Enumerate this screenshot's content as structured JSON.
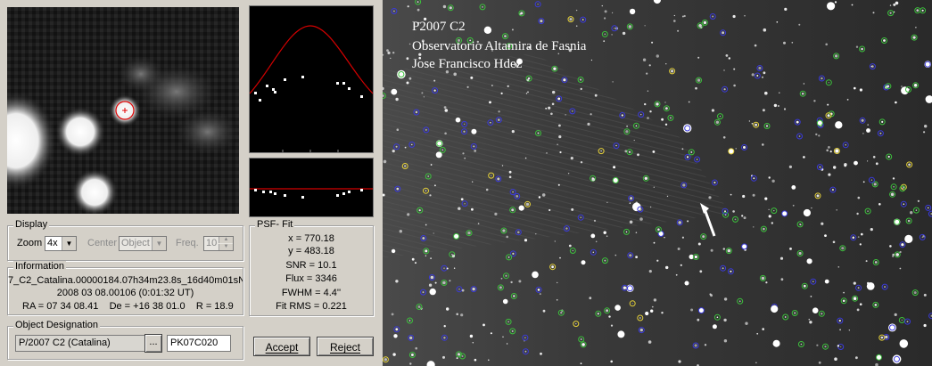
{
  "display": {
    "legend": "Display",
    "zoom_label": "Zoom",
    "zoom_value": "4x",
    "center_label": "Center",
    "center_value": "Object",
    "freq_label": "Freq.",
    "freq_value": "10"
  },
  "information": {
    "legend": "Information",
    "line1": "7_C2_Catalina.00000184.07h34m23.8s_16d40m01sN",
    "line2": "2008 03 08.00106 (0:01:32 UT)",
    "ra_label": "RA = 07 34 08.41",
    "de_label": "De = +16 38 01.0",
    "r_label": "R = 18.9"
  },
  "designation": {
    "legend": "Object Designation",
    "name": "P/2007 C2 (Catalina)",
    "code": "PK07C020"
  },
  "psf": {
    "legend": "PSF- Fit",
    "x": "x = 770.18",
    "y": "y = 483.18",
    "snr": "SNR = 10.1",
    "flux": "Flux = 3346",
    "fwhm": "FWHM = 4.4''",
    "rms": "Fit RMS = 0.221"
  },
  "buttons": {
    "accept": "Accept",
    "reject": "Reject",
    "browse": "..."
  },
  "sky_image": {
    "line1": "P2007 C2",
    "line2": "Observatorio Altamira de Fasnia",
    "line3": "Jose Francisco Hdez"
  },
  "colors": {
    "fit_curve": "#d40000",
    "reticle": "#e00000"
  }
}
